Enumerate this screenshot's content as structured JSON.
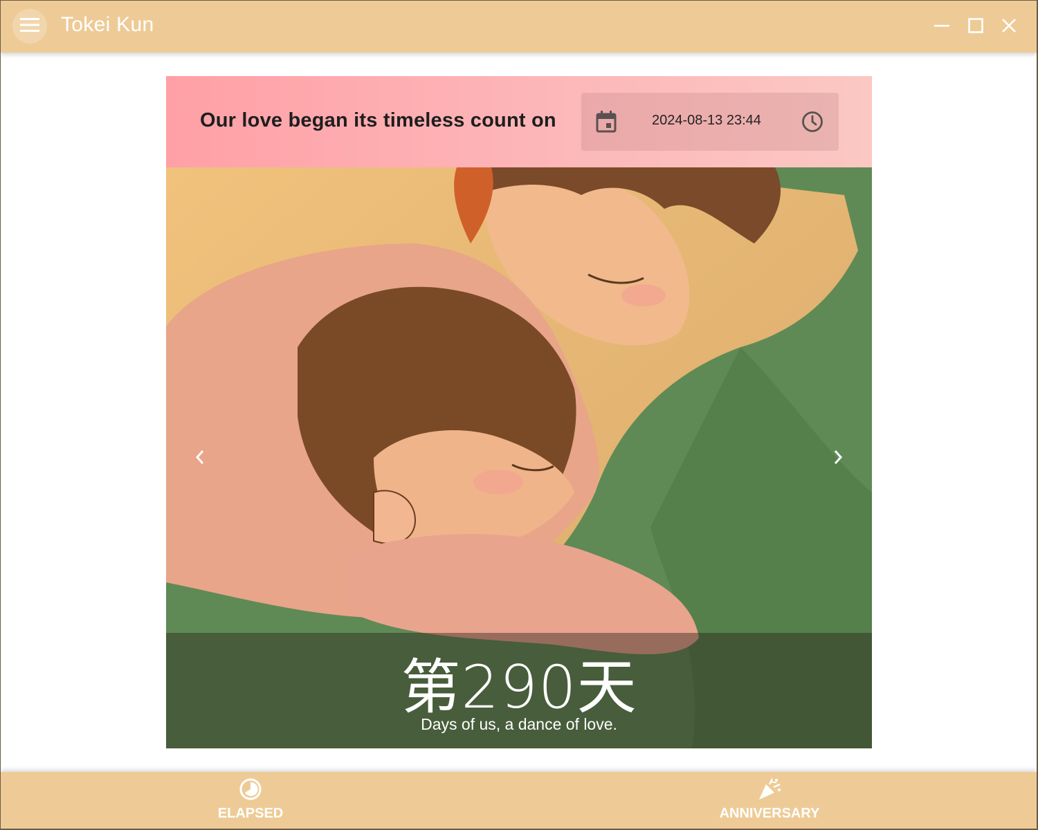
{
  "window": {
    "title": "Tokei Kun",
    "accent_color": "#eecb96",
    "controls": {
      "minimize_icon": "minimize-icon",
      "maximize_icon": "maximize-icon",
      "close_icon": "close-icon"
    },
    "menu_icon": "hamburger-menu-icon"
  },
  "card": {
    "header_text": "Our love began its timeless count on",
    "start_datetime": "2024-08-13 23:44",
    "calendar_icon": "calendar-icon",
    "clock_icon": "clock-icon",
    "prev_icon": "chevron-left-icon",
    "next_icon": "chevron-right-icon",
    "day_count": "第290天",
    "caption": "Days of us, a dance of love."
  },
  "bottom_nav": {
    "items": [
      {
        "label": "ELAPSED",
        "icon": "elapsed-timer-icon"
      },
      {
        "label": "ANNIVERSARY",
        "icon": "party-popper-icon"
      }
    ]
  }
}
